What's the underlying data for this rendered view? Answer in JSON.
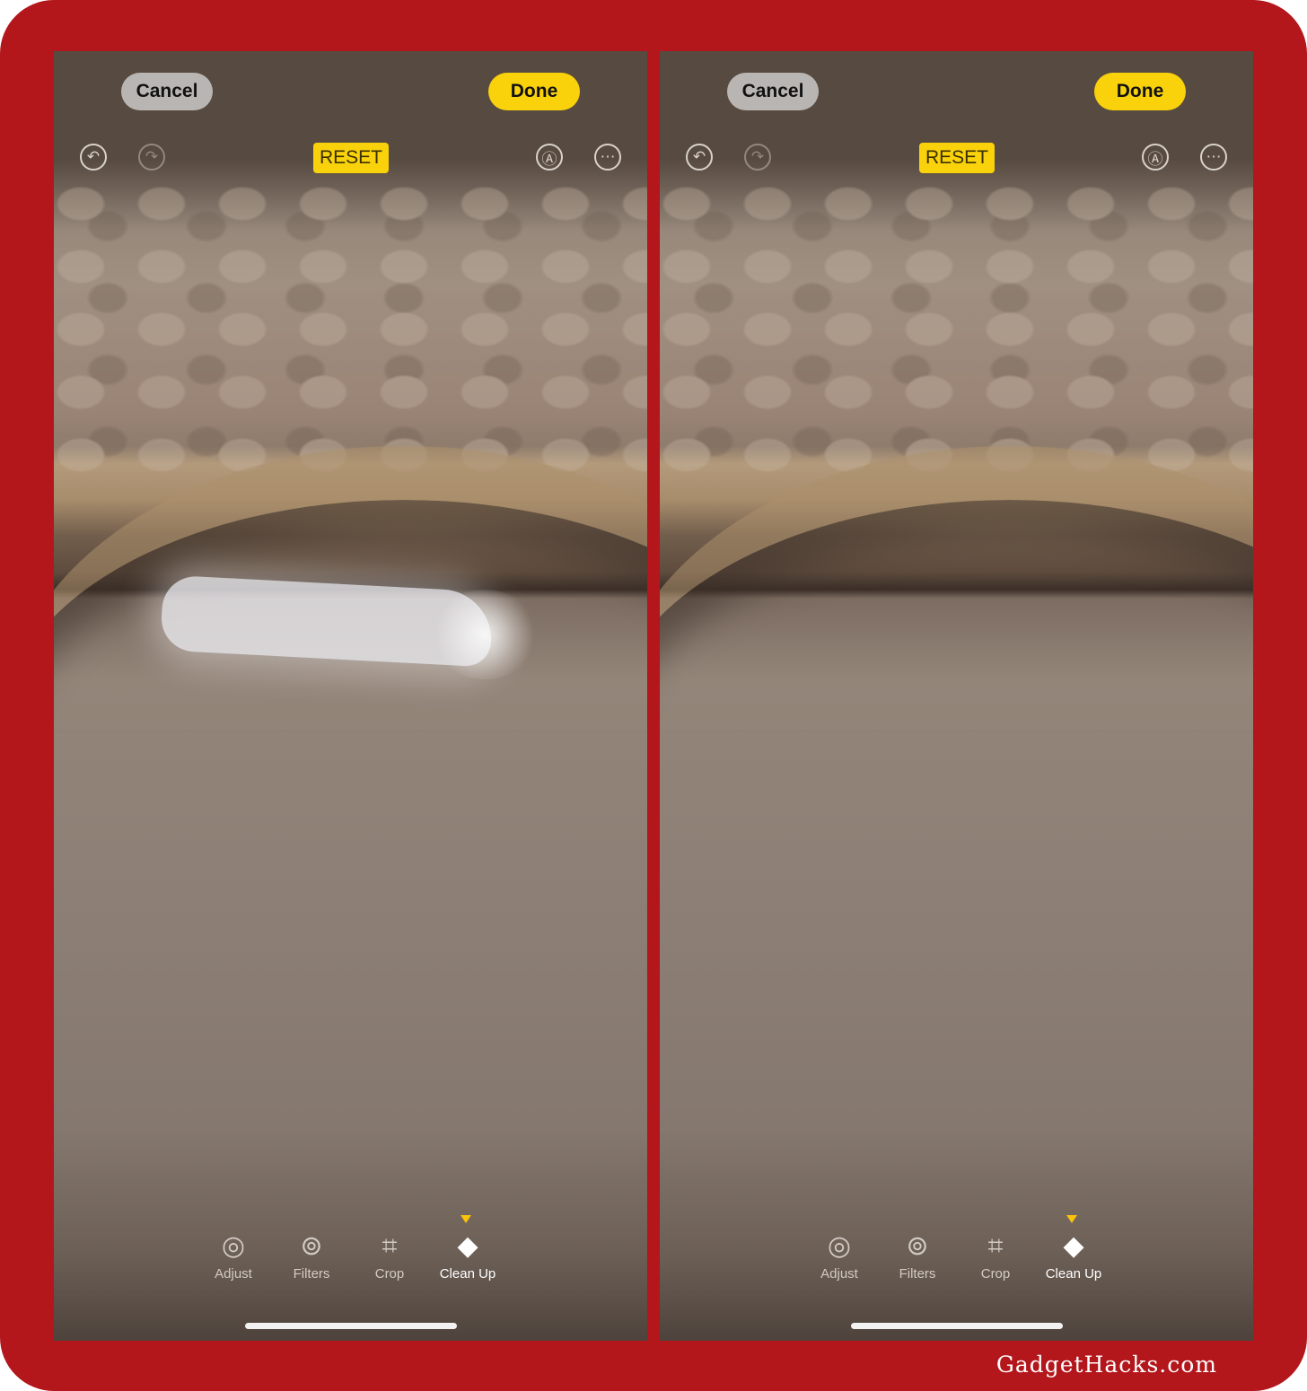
{
  "panels": [
    {
      "cancel": "Cancel",
      "done": "Done",
      "reset": "RESET",
      "icons": [
        "undo-icon",
        "redo-icon",
        "markup-icon",
        "more-icon"
      ],
      "tools": [
        {
          "label": "Adjust",
          "icon": "adjust-dial-icon"
        },
        {
          "label": "Filters",
          "icon": "filters-circles-icon"
        },
        {
          "label": "Crop",
          "icon": "crop-rotate-icon"
        },
        {
          "label": "Clean Up",
          "icon": "eraser-icon",
          "active": true
        }
      ],
      "state": "selection-mask-shown"
    },
    {
      "cancel": "Cancel",
      "done": "Done",
      "reset": "RESET",
      "icons": [
        "undo-icon",
        "redo-icon",
        "markup-icon",
        "more-icon"
      ],
      "tools": [
        {
          "label": "Adjust",
          "icon": "adjust-dial-icon"
        },
        {
          "label": "Filters",
          "icon": "filters-circles-icon"
        },
        {
          "label": "Crop",
          "icon": "crop-rotate-icon"
        },
        {
          "label": "Clean Up",
          "icon": "eraser-icon",
          "active": true
        }
      ],
      "state": "objects-removed"
    }
  ],
  "watermark": "GadgetHacks.com",
  "colors": {
    "frame": "#b3161b",
    "accent": "#f9d20c",
    "cancel_bg": "#b9b5b3"
  }
}
